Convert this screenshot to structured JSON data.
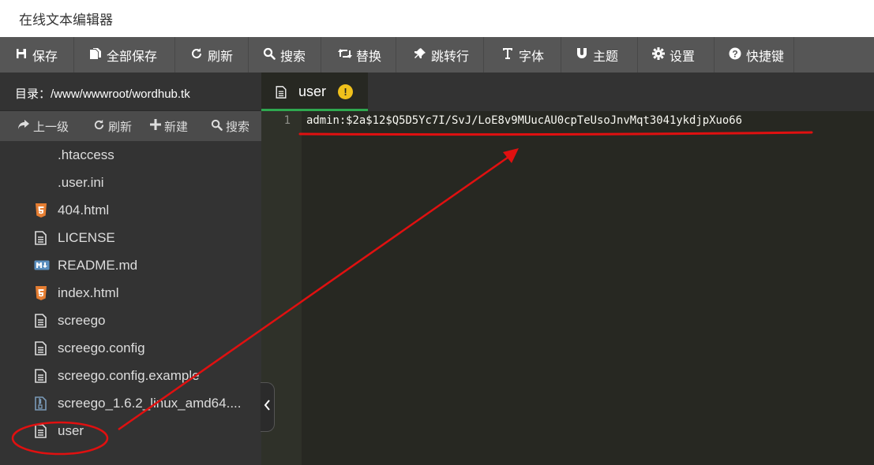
{
  "window": {
    "title": "在线文本编辑器"
  },
  "toolbar": {
    "buttons": [
      {
        "label": "保存",
        "icon": "save-icon"
      },
      {
        "label": "全部保存",
        "icon": "save-all-icon"
      },
      {
        "label": "刷新",
        "icon": "refresh-icon"
      },
      {
        "label": "搜索",
        "icon": "search-icon"
      },
      {
        "label": "替换",
        "icon": "replace-icon"
      },
      {
        "label": "跳转行",
        "icon": "pin-icon"
      },
      {
        "label": "字体",
        "icon": "font-icon"
      },
      {
        "label": "主题",
        "icon": "magnet-icon"
      },
      {
        "label": "设置",
        "icon": "gear-icon"
      },
      {
        "label": "快捷键",
        "icon": "question-icon"
      }
    ]
  },
  "sidebar": {
    "directory": "目录：/www/wwwroot/wordhub.tk",
    "actions": [
      {
        "label": "上一级",
        "icon": "share-arrow-icon"
      },
      {
        "label": "刷新",
        "icon": "refresh-icon"
      },
      {
        "label": "新建",
        "icon": "plus-icon"
      },
      {
        "label": "搜索",
        "icon": "search-icon"
      }
    ],
    "files": [
      {
        "name": ".htaccess",
        "icon": "none"
      },
      {
        "name": ".user.ini",
        "icon": "none"
      },
      {
        "name": "404.html",
        "icon": "html5-icon"
      },
      {
        "name": "LICENSE",
        "icon": "file-text-icon"
      },
      {
        "name": "README.md",
        "icon": "markdown-icon"
      },
      {
        "name": "index.html",
        "icon": "html5-icon"
      },
      {
        "name": "screego",
        "icon": "file-text-icon"
      },
      {
        "name": "screego.config",
        "icon": "file-text-icon"
      },
      {
        "name": "screego.config.example",
        "icon": "file-text-icon"
      },
      {
        "name": "screego_1.6.2_linux_amd64....",
        "icon": "archive-icon"
      },
      {
        "name": "user",
        "icon": "file-text-icon"
      }
    ]
  },
  "editor": {
    "tab": {
      "name": "user",
      "status": "!"
    },
    "lines": [
      {
        "number": "1",
        "text": "admin:$2a$12$Q5D5Yc7I/SvJ/LoE8v9MUucAU0cpTeUsoJnvMqt3041ykdjpXuo66"
      }
    ]
  },
  "colors": {
    "toolbar_bg": "#565656",
    "sidebar_bg": "#333333",
    "editor_bg": "#272822",
    "tab_active_border": "#2fa84f",
    "annotation": "#e01010"
  }
}
